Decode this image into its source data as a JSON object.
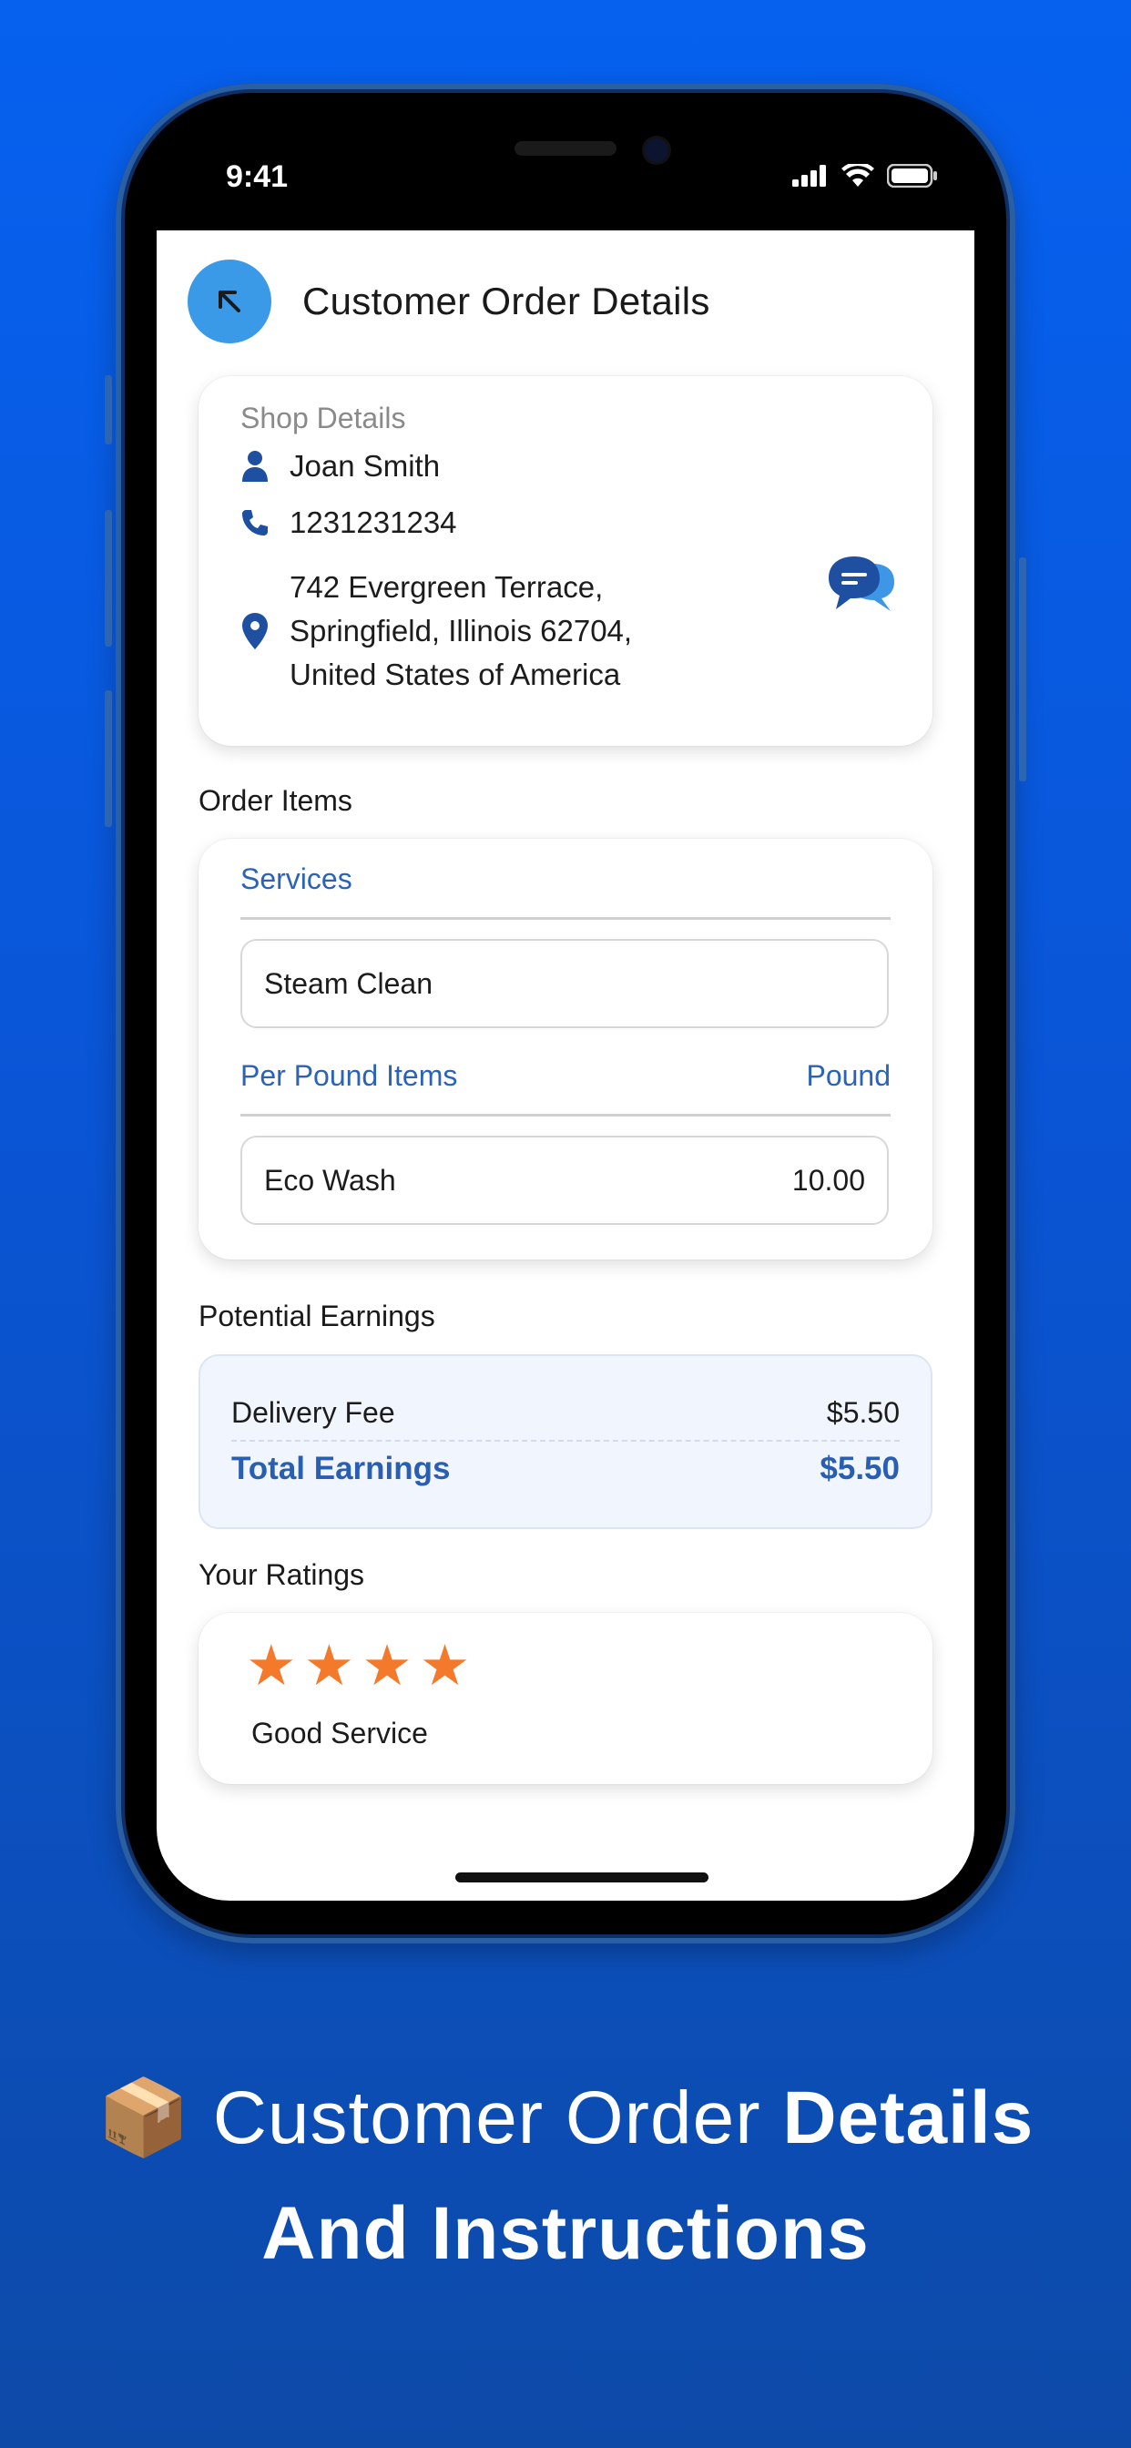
{
  "status_bar": {
    "time": "9:41"
  },
  "header": {
    "title": "Customer Order Details"
  },
  "shop": {
    "caption": "Shop Details",
    "name": "Joan Smith",
    "phone": "1231231234",
    "address_line1": "742 Evergreen Terrace,",
    "address_line2": "Springfield, Illinois 62704,",
    "address_line3": "United States of America"
  },
  "order_items": {
    "label": "Order Items",
    "services_header": "Services",
    "service_item": "Steam Clean",
    "per_pound_header": "Per Pound Items",
    "per_pound_unit": "Pound",
    "pound_item_name": "Eco Wash",
    "pound_item_qty": "10.00"
  },
  "earnings": {
    "label": "Potential Earnings",
    "delivery_fee_label": "Delivery Fee",
    "delivery_fee_value": "$5.50",
    "total_label": "Total Earnings",
    "total_value": "$5.50"
  },
  "ratings": {
    "label": "Your Ratings",
    "stars": 4,
    "comment": "Good Service"
  },
  "promo": {
    "emoji": "📦",
    "line1_light": "Customer Order",
    "line1_bold": "Details",
    "line2_bold": "And Instructions"
  },
  "colors": {
    "background": "#0a55d6",
    "accent_blue": "#2a63b8",
    "back_button": "#3a9ae8",
    "star": "#f5792a"
  }
}
